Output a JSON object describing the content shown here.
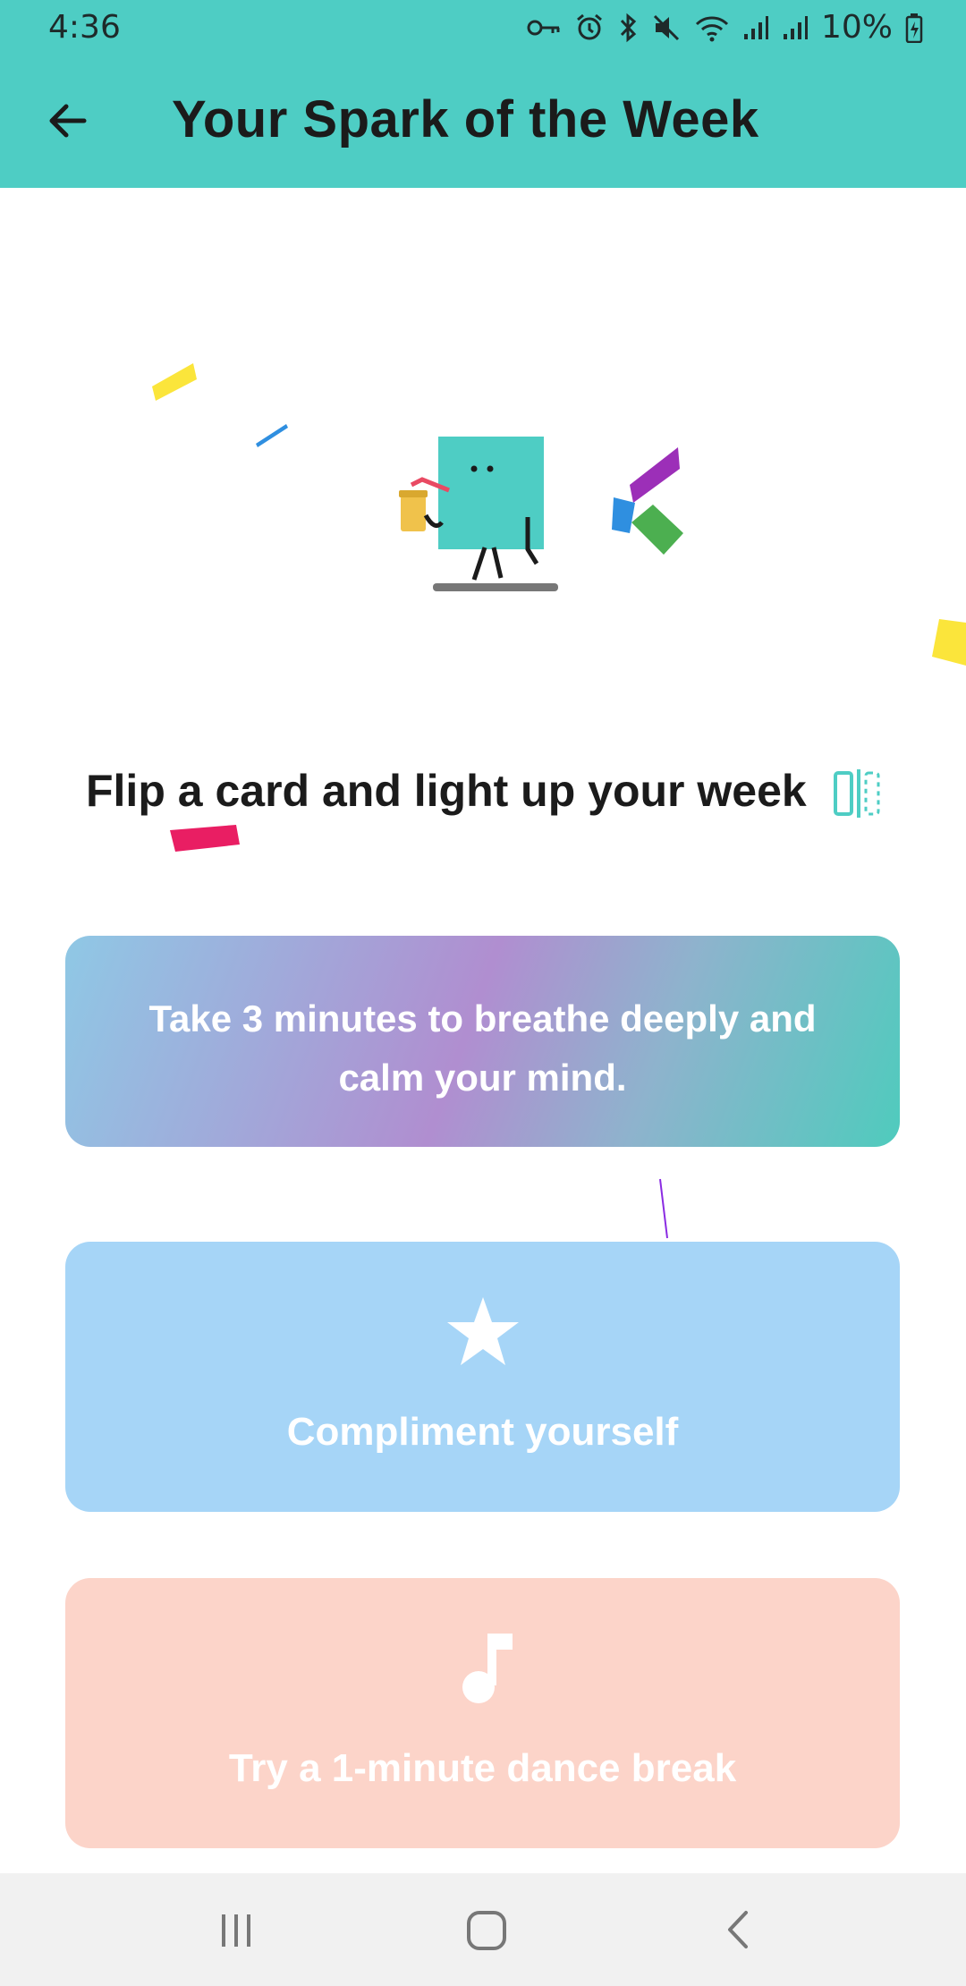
{
  "status_bar": {
    "time": "4:36",
    "battery": "10%",
    "icons": [
      "key-icon",
      "alarm-icon",
      "bluetooth-icon",
      "mute-icon",
      "wifi-icon",
      "signal-icon",
      "signal-icon",
      "battery-icon"
    ]
  },
  "app_bar": {
    "title": "Your Spark of the Week",
    "back_icon": "arrow-left-icon"
  },
  "main": {
    "subtitle": "Flip a card and light up your week",
    "flip_icon": "flip-card-icon"
  },
  "cards": [
    {
      "text": "Take 3 minutes to breathe deeply and calm your mind."
    },
    {
      "icon": "star-icon",
      "label": "Compliment yourself"
    },
    {
      "icon": "music-note-icon",
      "label": "Try a 1-minute dance break"
    }
  ],
  "colors": {
    "accent": "#4ecdc4",
    "card_blue": "#a6d5f7",
    "card_peach": "#fcd4c9"
  },
  "nav_bar": {
    "icons": [
      "recents-icon",
      "home-icon",
      "back-icon"
    ]
  }
}
